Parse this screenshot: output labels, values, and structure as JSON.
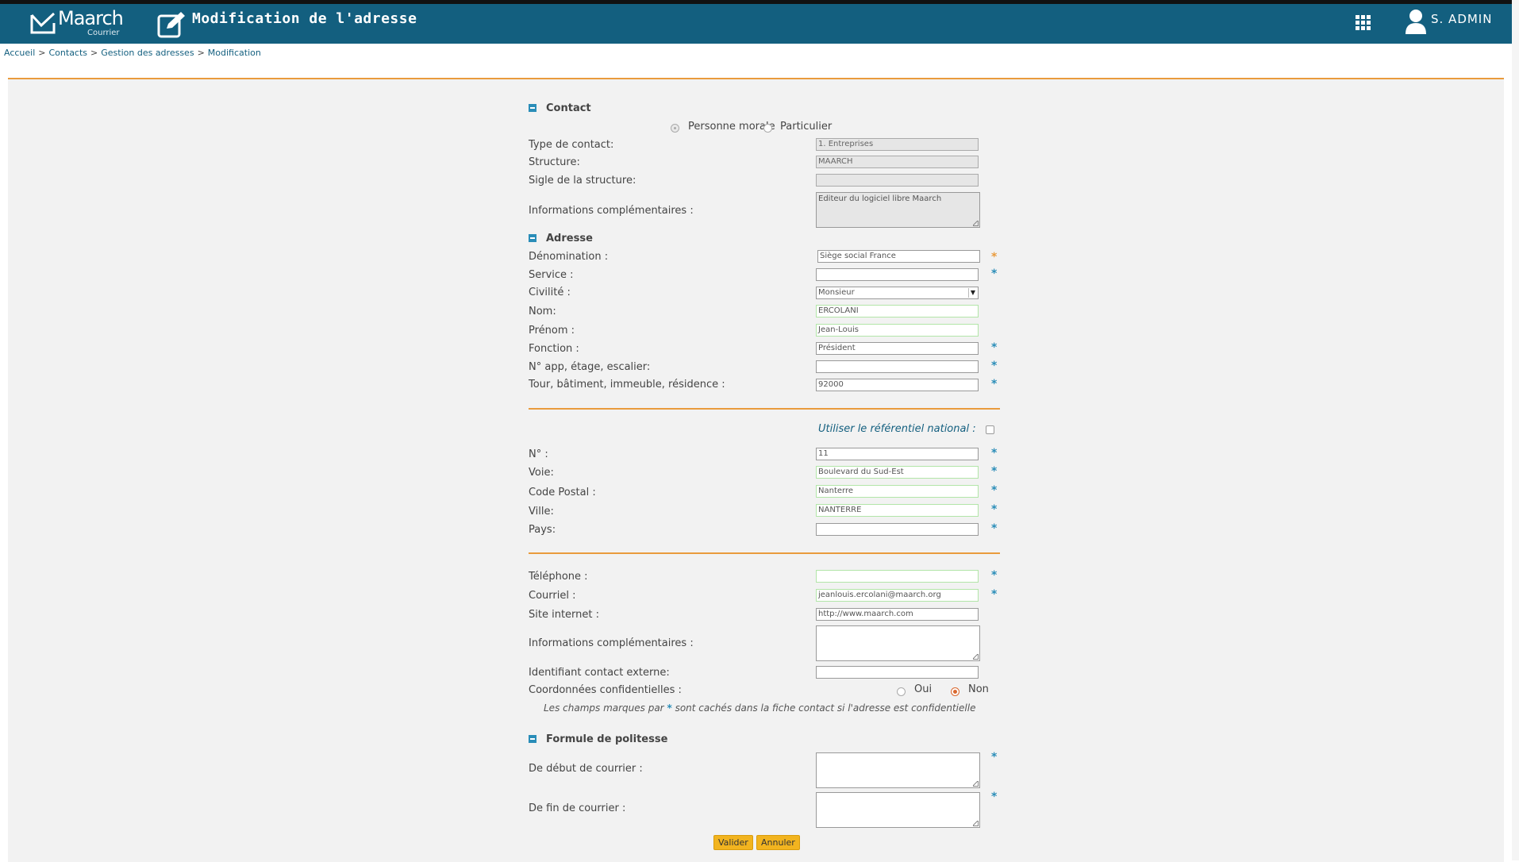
{
  "header": {
    "logo_text": "Maarch",
    "logo_sub": "Courrier",
    "title": "Modification de l'adresse",
    "user_name": "S. ADMIN"
  },
  "breadcrumb": [
    "Accueil",
    "Contacts",
    "Gestion des adresses",
    "Modification"
  ],
  "contact": {
    "section_title": "Contact",
    "type_options": [
      "Personne morale",
      "Particulier"
    ],
    "type_label": "Type de contact:",
    "type_value": "1. Entreprises",
    "structure_label": "Structure:",
    "structure_value": "MAARCH",
    "sigle_label": "Sigle de la structure:",
    "sigle_value": "",
    "info_label": "Informations complémentaires :",
    "info_value": "Editeur du logiciel libre Maarch"
  },
  "adresse": {
    "section_title": "Adresse",
    "denomination_label": "Dénomination :",
    "denomination_value": "Siège social France",
    "service_label": "Service :",
    "service_value": "",
    "civilite_label": "Civilité :",
    "civilite_value": "Monsieur",
    "nom_label": "Nom:",
    "nom_value": "ERCOLANI",
    "prenom_label": "Prénom :",
    "prenom_value": "Jean-Louis",
    "fonction_label": "Fonction :",
    "fonction_value": "Président",
    "app_label": "N° app, étage, escalier:",
    "app_value": "",
    "tour_label": "Tour, bâtiment, immeuble, résidence :",
    "tour_value": "92000",
    "referentiel_label": "Utiliser le référentiel national :",
    "numero_label": "N° :",
    "numero_value": "11",
    "voie_label": "Voie:",
    "voie_value": "Boulevard du Sud-Est",
    "cp_label": "Code Postal :",
    "cp_value": "Nanterre",
    "ville_label": "Ville:",
    "ville_value": "NANTERRE",
    "pays_label": "Pays:",
    "pays_value": "",
    "telephone_label": "Téléphone :",
    "telephone_value": "",
    "courriel_label": "Courriel :",
    "courriel_value": "jeanlouis.ercolani@maarch.org",
    "site_label": "Site internet :",
    "site_value": "http://www.maarch.com",
    "info_label": "Informations complémentaires :",
    "info_value": "",
    "ext_id_label": "Identifiant contact externe:",
    "ext_id_value": "",
    "confid_label": "Coordonnées confidentielles :",
    "confid_options": [
      "Oui",
      "Non"
    ],
    "confid_selected": "Non",
    "note_before": "Les champs marques par",
    "note_star": "*",
    "note_after": "sont cachés dans la fiche contact si l'adresse est confidentielle"
  },
  "politesse": {
    "section_title": "Formule de politesse",
    "debut_label": "De début de courrier :",
    "debut_value": "",
    "fin_label": "De fin de courrier :",
    "fin_value": ""
  },
  "buttons": {
    "validate": "Valider",
    "cancel": "Annuler"
  },
  "colors": {
    "header_bg": "#135f7f",
    "accent": "#e99b3d",
    "star": "#2a8db8",
    "button": "#f2b41f"
  }
}
